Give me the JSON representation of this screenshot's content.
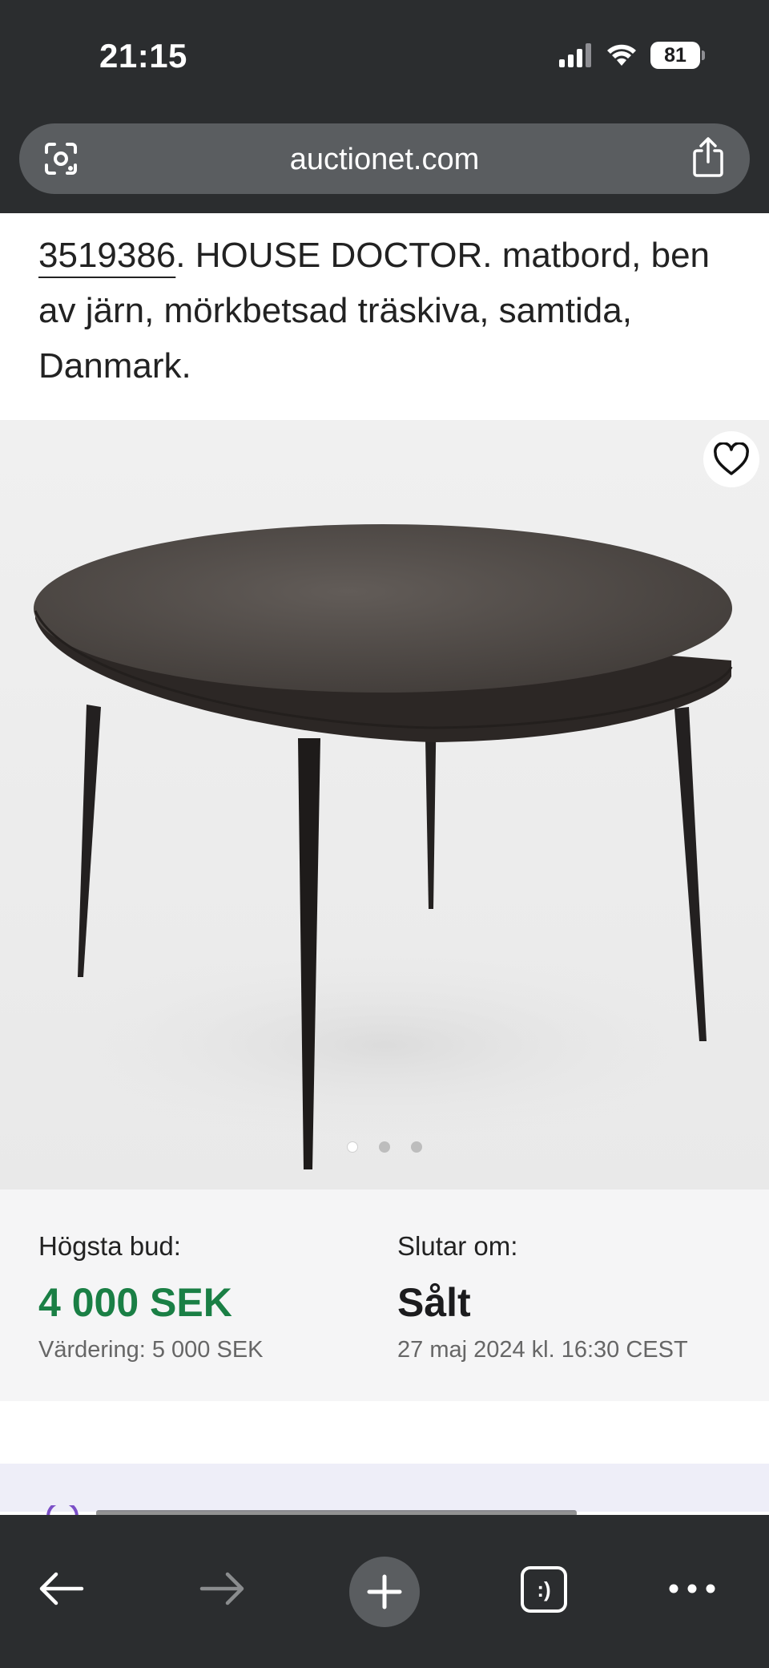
{
  "status_bar": {
    "time": "21:15",
    "battery": "81"
  },
  "browser": {
    "url": "auctionet.com"
  },
  "lot": {
    "number": "3519386",
    "title_rest": ". HOUSE DOCTOR. matbord, ben av järn, mörkbetsad träskiva, samtida, Danmark."
  },
  "gallery": {
    "image_count": 3,
    "active_index": 0
  },
  "bid": {
    "highest_label": "Högsta bud:",
    "highest_value": "4 000 SEK",
    "estimate": "Värdering: 5 000 SEK",
    "ends_label": "Slutar om:",
    "status": "Sålt",
    "end_date": "27 maj 2024 kl. 16:30 CEST"
  },
  "colors": {
    "bid_green": "#1a7f45",
    "chrome": "#2b2d2f"
  }
}
